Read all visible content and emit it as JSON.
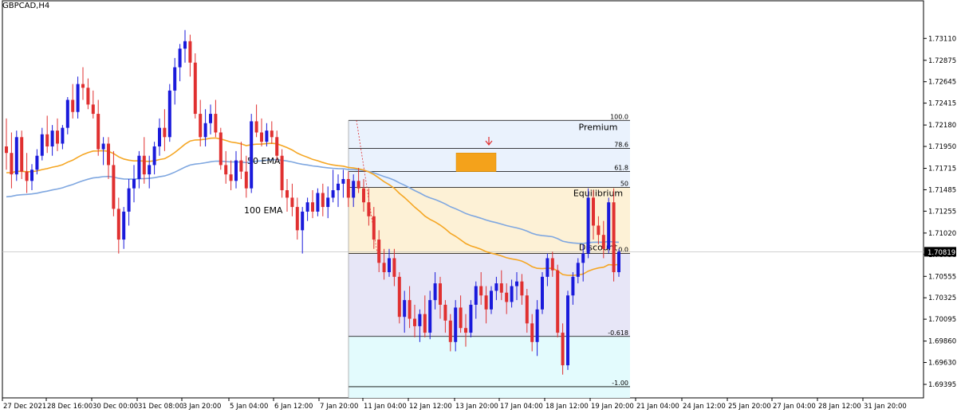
{
  "symbol_label": "GBPCAD,H4",
  "chart_data": {
    "type": "candlestick",
    "symbol": "GBPCAD",
    "timeframe": "H4",
    "y_range": [
      1.6925,
      1.7342
    ],
    "y_ticks": [
      "1.73110",
      "1.72875",
      "1.72645",
      "1.72415",
      "1.72180",
      "1.71950",
      "1.71715",
      "1.71485",
      "1.71255",
      "1.71020",
      "1.70790",
      "1.70555",
      "1.70325",
      "1.70095",
      "1.69860",
      "1.69630",
      "1.69395"
    ],
    "current_price": "1.70819",
    "x_ticks": [
      "27 Dec 2021",
      "28 Dec 16:00",
      "30 Dec 00:00",
      "31 Dec 08:00",
      "3 Jan 20:00",
      "5 Jan 04:00",
      "6 Jan 12:00",
      "7 Jan 20:00",
      "11 Jan 04:00",
      "12 Jan 12:00",
      "13 Jan 20:00",
      "17 Jan 04:00",
      "18 Jan 12:00",
      "19 Jan 20:00",
      "21 Jan 04:00",
      "24 Jan 12:00",
      "25 Jan 20:00",
      "27 Jan 04:00",
      "28 Jan 12:00",
      "31 Jan 20:00"
    ],
    "candles": [
      [
        1.7195,
        1.7225,
        1.717,
        1.7188
      ],
      [
        1.7188,
        1.721,
        1.715,
        1.7165
      ],
      [
        1.7165,
        1.7212,
        1.7158,
        1.7205
      ],
      [
        1.7205,
        1.7212,
        1.716,
        1.7168
      ],
      [
        1.7168,
        1.7188,
        1.7145,
        1.7158
      ],
      [
        1.7158,
        1.7176,
        1.7148,
        1.717
      ],
      [
        1.717,
        1.7192,
        1.7165,
        1.7185
      ],
      [
        1.7185,
        1.7215,
        1.718,
        1.7208
      ],
      [
        1.7208,
        1.7228,
        1.7188,
        1.7195
      ],
      [
        1.7195,
        1.7218,
        1.7185,
        1.7212
      ],
      [
        1.7212,
        1.7225,
        1.719,
        1.7198
      ],
      [
        1.7198,
        1.7218,
        1.7192,
        1.7215
      ],
      [
        1.7215,
        1.7248,
        1.7208,
        1.7245
      ],
      [
        1.7245,
        1.7262,
        1.7225,
        1.7232
      ],
      [
        1.7232,
        1.727,
        1.7225,
        1.7262
      ],
      [
        1.7262,
        1.728,
        1.7245,
        1.7258
      ],
      [
        1.7258,
        1.7268,
        1.7235,
        1.724
      ],
      [
        1.724,
        1.7255,
        1.7225,
        1.723
      ],
      [
        1.723,
        1.7245,
        1.7185,
        1.7192
      ],
      [
        1.7192,
        1.7205,
        1.7175,
        1.7198
      ],
      [
        1.7198,
        1.7205,
        1.716,
        1.7175
      ],
      [
        1.7175,
        1.719,
        1.712,
        1.7128
      ],
      [
        1.7128,
        1.714,
        1.708,
        1.7095
      ],
      [
        1.7095,
        1.713,
        1.7085,
        1.7125
      ],
      [
        1.7125,
        1.716,
        1.711,
        1.715
      ],
      [
        1.715,
        1.7175,
        1.7135,
        1.716
      ],
      [
        1.716,
        1.719,
        1.715,
        1.7185
      ],
      [
        1.7185,
        1.7205,
        1.7155,
        1.7165
      ],
      [
        1.7165,
        1.7185,
        1.715,
        1.7175
      ],
      [
        1.7175,
        1.72,
        1.7165,
        1.7195
      ],
      [
        1.7195,
        1.7225,
        1.7185,
        1.7215
      ],
      [
        1.7215,
        1.7235,
        1.719,
        1.7205
      ],
      [
        1.7205,
        1.7262,
        1.72,
        1.7255
      ],
      [
        1.7255,
        1.729,
        1.724,
        1.728
      ],
      [
        1.728,
        1.7305,
        1.7265,
        1.73
      ],
      [
        1.73,
        1.732,
        1.7285,
        1.7308
      ],
      [
        1.7308,
        1.7315,
        1.727,
        1.7285
      ],
      [
        1.7285,
        1.7295,
        1.7225,
        1.723
      ],
      [
        1.723,
        1.7245,
        1.7195,
        1.7205
      ],
      [
        1.7205,
        1.7235,
        1.7195,
        1.722
      ],
      [
        1.722,
        1.724,
        1.7208,
        1.723
      ],
      [
        1.723,
        1.7245,
        1.7205,
        1.721
      ],
      [
        1.721,
        1.7215,
        1.717,
        1.7175
      ],
      [
        1.7175,
        1.719,
        1.7155,
        1.7165
      ],
      [
        1.7165,
        1.718,
        1.7148,
        1.7158
      ],
      [
        1.7158,
        1.719,
        1.715,
        1.718
      ],
      [
        1.718,
        1.72,
        1.716,
        1.7168
      ],
      [
        1.7168,
        1.7185,
        1.714,
        1.715
      ],
      [
        1.715,
        1.723,
        1.7145,
        1.7222
      ],
      [
        1.7222,
        1.724,
        1.7205,
        1.721
      ],
      [
        1.721,
        1.7225,
        1.7195,
        1.72
      ],
      [
        1.72,
        1.722,
        1.7195,
        1.7212
      ],
      [
        1.7212,
        1.7222,
        1.7198,
        1.7205
      ],
      [
        1.7205,
        1.7212,
        1.718,
        1.7185
      ],
      [
        1.7185,
        1.7192,
        1.714,
        1.7148
      ],
      [
        1.7148,
        1.716,
        1.7125,
        1.714
      ],
      [
        1.714,
        1.7155,
        1.712,
        1.713
      ],
      [
        1.713,
        1.714,
        1.7095,
        1.7105
      ],
      [
        1.7105,
        1.713,
        1.708,
        1.7125
      ],
      [
        1.7125,
        1.714,
        1.7115,
        1.7135
      ],
      [
        1.7135,
        1.7148,
        1.7118,
        1.7125
      ],
      [
        1.7125,
        1.715,
        1.712,
        1.7145
      ],
      [
        1.7145,
        1.7155,
        1.712,
        1.713
      ],
      [
        1.713,
        1.7152,
        1.7118,
        1.714
      ],
      [
        1.714,
        1.717,
        1.7135,
        1.7148
      ],
      [
        1.7148,
        1.7165,
        1.713,
        1.7155
      ],
      [
        1.7155,
        1.717,
        1.714,
        1.716
      ],
      [
        1.716,
        1.7168,
        1.713,
        1.714
      ],
      [
        1.714,
        1.7165,
        1.713,
        1.7158
      ],
      [
        1.7158,
        1.7172,
        1.7145,
        1.715
      ],
      [
        1.715,
        1.716,
        1.7125,
        1.7135
      ],
      [
        1.7135,
        1.715,
        1.711,
        1.712
      ],
      [
        1.712,
        1.713,
        1.7085,
        1.7095
      ],
      [
        1.7095,
        1.7105,
        1.706,
        1.707
      ],
      [
        1.707,
        1.7085,
        1.7052,
        1.706
      ],
      [
        1.706,
        1.7085,
        1.7055,
        1.7075
      ],
      [
        1.7075,
        1.7085,
        1.7045,
        1.7055
      ],
      [
        1.7055,
        1.706,
        1.7005,
        1.7012
      ],
      [
        1.7012,
        1.704,
        1.6995,
        1.703
      ],
      [
        1.703,
        1.7045,
        1.7,
        1.701
      ],
      [
        1.701,
        1.7025,
        1.699,
        1.7002
      ],
      [
        1.7002,
        1.702,
        1.6985,
        1.7015
      ],
      [
        1.7015,
        1.7035,
        1.699,
        1.6995
      ],
      [
        1.6995,
        1.704,
        1.6988,
        1.703
      ],
      [
        1.703,
        1.706,
        1.702,
        1.7048
      ],
      [
        1.7048,
        1.7055,
        1.701,
        1.7025
      ],
      [
        1.7025,
        1.703,
        1.6995,
        1.7008
      ],
      [
        1.7008,
        1.7015,
        1.6975,
        1.6985
      ],
      [
        1.6985,
        1.703,
        1.6975,
        1.7022
      ],
      [
        1.7022,
        1.7035,
        1.6995,
        1.7
      ],
      [
        1.7,
        1.7015,
        1.698,
        1.6995
      ],
      [
        1.6995,
        1.703,
        1.699,
        1.7025
      ],
      [
        1.7025,
        1.705,
        1.701,
        1.7045
      ],
      [
        1.7045,
        1.706,
        1.7025,
        1.7035
      ],
      [
        1.7035,
        1.7045,
        1.7005,
        1.702
      ],
      [
        1.702,
        1.7045,
        1.7015,
        1.704
      ],
      [
        1.704,
        1.7055,
        1.703,
        1.7048
      ],
      [
        1.7048,
        1.7062,
        1.703,
        1.7038
      ],
      [
        1.7038,
        1.7048,
        1.7015,
        1.7028
      ],
      [
        1.7028,
        1.7052,
        1.7022,
        1.7045
      ],
      [
        1.7045,
        1.706,
        1.703,
        1.705
      ],
      [
        1.705,
        1.7058,
        1.7025,
        1.7035
      ],
      [
        1.7035,
        1.7042,
        1.6995,
        1.7005
      ],
      [
        1.7005,
        1.7015,
        1.6975,
        1.6985
      ],
      [
        1.6985,
        1.703,
        1.697,
        1.702
      ],
      [
        1.702,
        1.706,
        1.7015,
        1.7055
      ],
      [
        1.7055,
        1.708,
        1.7045,
        1.7075
      ],
      [
        1.7075,
        1.7082,
        1.7055,
        1.7062
      ],
      [
        1.7062,
        1.7068,
        1.699,
        1.6995
      ],
      [
        1.6995,
        1.7005,
        1.695,
        1.696
      ],
      [
        1.696,
        1.704,
        1.6955,
        1.7035
      ],
      [
        1.7035,
        1.706,
        1.7025,
        1.7055
      ],
      [
        1.7055,
        1.7075,
        1.7048,
        1.707
      ],
      [
        1.707,
        1.709,
        1.705,
        1.708
      ],
      [
        1.708,
        1.715,
        1.7075,
        1.714
      ],
      [
        1.714,
        1.7148,
        1.7095,
        1.711
      ],
      [
        1.711,
        1.712,
        1.709,
        1.71
      ],
      [
        1.71,
        1.7115,
        1.7075,
        1.7085
      ],
      [
        1.7085,
        1.714,
        1.708,
        1.7135
      ],
      [
        1.7135,
        1.715,
        1.705,
        1.706
      ],
      [
        1.706,
        1.7085,
        1.7055,
        1.7082
      ]
    ],
    "ema_50": {
      "label": "50 EMA",
      "color": "#f5a623"
    },
    "ema_100": {
      "label": "100 EMA",
      "color": "#7fa7e0"
    },
    "fib_levels": [
      {
        "label": "100.0",
        "value": 1.7223
      },
      {
        "label": "78.6",
        "value": 1.7193
      },
      {
        "label": "61.8",
        "value": 1.7168
      },
      {
        "label": "50",
        "value": 1.7151
      },
      {
        "label": "0.0",
        "value": 1.708
      },
      {
        "label": "-0.618",
        "value": 1.6991
      },
      {
        "label": "-1.00",
        "value": 1.6937
      }
    ],
    "zones": [
      {
        "label": "Premium"
      },
      {
        "label": "Equilibrium"
      },
      {
        "label": "Discount"
      }
    ],
    "supply_box": {
      "low": 1.7168,
      "high": 1.7188
    },
    "colors": {
      "bull": "#1a1adb",
      "bear": "#e03030",
      "premium": "#eaf2fd",
      "equilibrium": "#fdf1d6",
      "discount": "#e7e6f7",
      "extension": "#e3fbfd",
      "box": "#f4a21b"
    }
  }
}
